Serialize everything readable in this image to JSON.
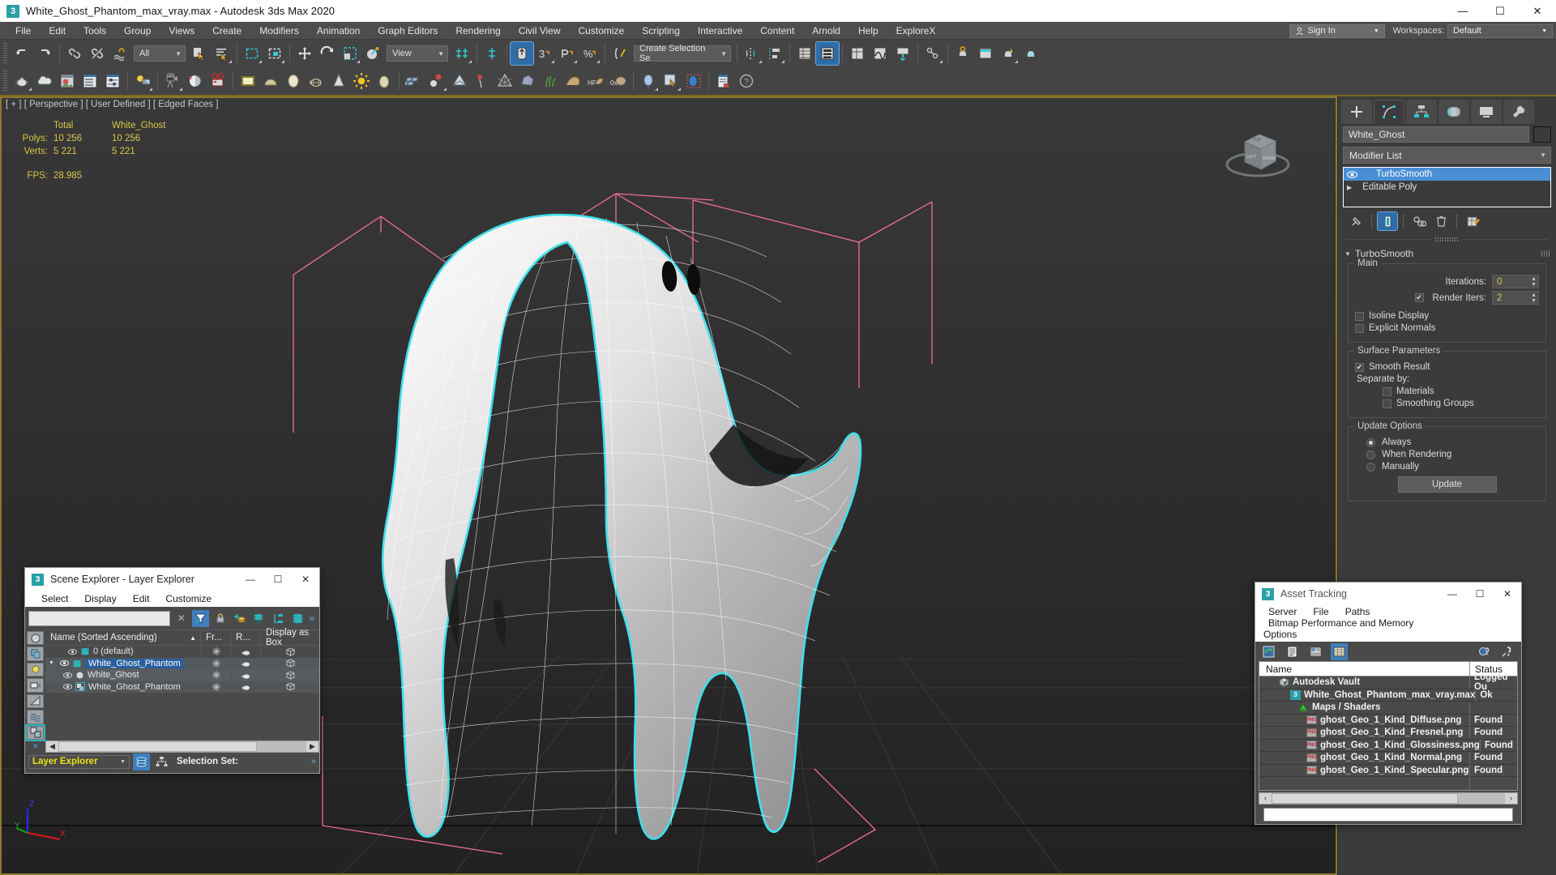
{
  "titlebar": {
    "app_icon": "3",
    "title": "White_Ghost_Phantom_max_vray.max - Autodesk 3ds Max 2020",
    "minimize": "—",
    "maximize": "☐",
    "close": "✕"
  },
  "menubar": {
    "items": [
      "File",
      "Edit",
      "Tools",
      "Group",
      "Views",
      "Create",
      "Modifiers",
      "Animation",
      "Graph Editors",
      "Rendering",
      "Civil View",
      "Customize",
      "Scripting",
      "Interactive",
      "Content",
      "Arnold",
      "Help",
      "ExploreX"
    ],
    "sign_in": "Sign In",
    "workspaces_label": "Workspaces:",
    "workspace_value": "Default"
  },
  "toolbar": {
    "selection_filter": "All",
    "reference_coordinate": "View",
    "named_selection_sets": "Create Selection Se",
    "row1_icons": [
      "undo-icon",
      "redo-icon",
      "select-and-link-icon",
      "unlink-selection-icon",
      "bind-to-space-warp-icon",
      "select-object-icon",
      "select-by-name-icon",
      "rectangular-selection-region-icon",
      "window-crossing-icon",
      "select-and-move-icon",
      "select-and-rotate-icon",
      "select-and-scale-icon",
      "placement-tool-icon",
      "use-center-flyout-icon",
      "select-and-manipulate-icon",
      "snaps-toggle-icon",
      "angle-snap-icon",
      "percent-snap-icon",
      "spinner-snap-icon",
      "edit-named-selection-icon",
      "mirror-icon",
      "align-icon",
      "layer-explorer-icon",
      "scene-explorer-icon",
      "toggle-scene-explorer-icon",
      "curve-editor-icon",
      "schematic-view-icon",
      "material-editor-icon",
      "render-setup-icon",
      "rendered-frame-window-icon",
      "render-production-icon",
      "render-iterative-icon"
    ],
    "row2_icons": [
      "teapot-icon",
      "cloud-icon",
      "bitmap-icon",
      "properties-icon",
      "adjust-icon",
      "light-icon",
      "camera-icon",
      "helper-icon",
      "render-camera-icon",
      "plane-icon",
      "dome-icon",
      "sphere-icon",
      "wireframe-teapot-icon",
      "cone-icon",
      "sun-icon",
      "egg-icon",
      "cloth-icon",
      "particle-icon",
      "envelope-icon",
      "pin-icon",
      "pyramid-icon",
      "rock-icon",
      "grass-icon",
      "fur-icon",
      "hf-icon",
      "ox-icon",
      "balloon-icon",
      "map-pick-icon",
      "selection-balloon-icon",
      "document-icon",
      "help-icon"
    ]
  },
  "viewport": {
    "label": "[ + ] [ Perspective ] [ User Defined ] [ Edged Faces ]",
    "stats": {
      "col_total": "Total",
      "col_object": "White_Ghost",
      "rows": [
        {
          "label": "Polys:",
          "total": "10 256",
          "object": "10 256"
        },
        {
          "label": "Verts:",
          "total": "5 221",
          "object": "5 221"
        }
      ],
      "fps_label": "FPS:",
      "fps_value": "28.985"
    },
    "axis": {
      "x": "X",
      "y": "Y",
      "z": "Z"
    },
    "viewcube": {
      "top": "TOP",
      "left": "LEFT",
      "front": "FRONT"
    },
    "colors": {
      "selection_outline": "#3ee0ec",
      "gizmo_pink": "#f06ba0",
      "axis_x": "#d01818",
      "axis_y": "#11a011",
      "axis_z": "#2a2aee",
      "stats_text": "#d8c84a",
      "viewport_border": "#8a7a2e"
    }
  },
  "command_panel": {
    "tabs": [
      {
        "name": "create-tab",
        "icon": "plus-icon",
        "active": false
      },
      {
        "name": "modify-tab",
        "icon": "modify-icon",
        "active": true
      },
      {
        "name": "hierarchy-tab",
        "icon": "hierarchy-icon",
        "active": false
      },
      {
        "name": "motion-tab",
        "icon": "motion-icon",
        "active": false
      },
      {
        "name": "display-tab",
        "icon": "display-icon",
        "active": false
      },
      {
        "name": "utilities-tab",
        "icon": "wrench-icon",
        "active": false
      }
    ],
    "object_name": "White_Ghost",
    "modifier_list_label": "Modifier List",
    "stack": [
      {
        "label": "TurboSmooth",
        "selected": true
      },
      {
        "label": "Editable Poly",
        "selected": false
      }
    ],
    "stack_tools": [
      "pin-stack-icon",
      "show-end-result-icon",
      "make-unique-icon",
      "remove-modifier-icon",
      "configure-sets-icon"
    ],
    "rollout": {
      "title": "TurboSmooth",
      "main": {
        "group_title": "Main",
        "iterations_label": "Iterations:",
        "iterations_value": "0",
        "render_iters_label": "Render Iters:",
        "render_iters_value": "2",
        "render_iters_checked": true,
        "isoline_display_label": "Isoline Display",
        "isoline_display_checked": false,
        "explicit_normals_label": "Explicit Normals",
        "explicit_normals_checked": false
      },
      "surface": {
        "group_title": "Surface Parameters",
        "smooth_result_label": "Smooth Result",
        "smooth_result_checked": true,
        "separate_by_label": "Separate by:",
        "materials_label": "Materials",
        "materials_checked": false,
        "smoothing_groups_label": "Smoothing Groups",
        "smoothing_groups_checked": false
      },
      "update": {
        "group_title": "Update Options",
        "always_label": "Always",
        "when_rendering_label": "When Rendering",
        "manually_label": "Manually",
        "selected": "Always",
        "button_label": "Update"
      }
    }
  },
  "scene_explorer": {
    "app_icon": "3",
    "title": "Scene Explorer - Layer Explorer",
    "minimize": "—",
    "maximize": "☐",
    "close": "✕",
    "menu": [
      "Select",
      "Display",
      "Edit",
      "Customize"
    ],
    "search_value": "",
    "clear_icon": "✕",
    "toolbar_icons": [
      "filter-icon",
      "lock-icon",
      "add-layer-icon",
      "select-highlighted-icon",
      "layer-hierarchy-icon",
      "layers-icon"
    ],
    "overflow": "»",
    "columns": [
      "Name (Sorted Ascending)",
      "Fr...",
      "R...",
      "Display as Box"
    ],
    "sort_arrow": "▲",
    "rows": [
      {
        "indent": 1,
        "name": "0 (default)",
        "type": "layer",
        "selected": false,
        "expanded": false,
        "arrow": ""
      },
      {
        "indent": 1,
        "name": "White_Ghost_Phantom",
        "type": "layer",
        "selected": true,
        "expanded": true,
        "arrow": "▼"
      },
      {
        "indent": 2,
        "name": "White_Ghost",
        "type": "object",
        "selected": false,
        "expanded": false,
        "arrow": ""
      },
      {
        "indent": 2,
        "name": "White_Ghost_Phantom",
        "type": "group",
        "selected": false,
        "expanded": false,
        "arrow": ""
      }
    ],
    "footer_combo": "Layer Explorer",
    "selection_set_label": "Selection Set:",
    "footer_icons": [
      "layers-view-icon",
      "hierarchy-view-icon"
    ]
  },
  "asset_tracking": {
    "app_icon": "3",
    "title": "Asset Tracking",
    "minimize": "—",
    "maximize": "☐",
    "close": "✕",
    "menu": [
      "Server",
      "File",
      "Paths",
      "Bitmap Performance and Memory",
      "Options"
    ],
    "toolbar_icons": [
      "refresh-icon",
      "list-view-icon",
      "detail-view-icon",
      "grid-view-icon"
    ],
    "right_icons": [
      "add-help-icon",
      "help-icon"
    ],
    "columns": [
      "Name",
      "Status"
    ],
    "rows": [
      {
        "indent": 1,
        "icon": "vault-icon",
        "name": "Autodesk Vault",
        "status": "Logged Ou"
      },
      {
        "indent": 2,
        "icon": "max-icon",
        "name": "White_Ghost_Phantom_max_vray.max",
        "status": "Ok"
      },
      {
        "indent": 2,
        "icon": "maps-icon",
        "name": "Maps / Shaders",
        "status": ""
      },
      {
        "indent": 3,
        "icon": "png-icon",
        "name": "ghost_Geo_1_Kind_Diffuse.png",
        "status": "Found"
      },
      {
        "indent": 3,
        "icon": "png-icon",
        "name": "ghost_Geo_1_Kind_Fresnel.png",
        "status": "Found"
      },
      {
        "indent": 3,
        "icon": "png-icon",
        "name": "ghost_Geo_1_Kind_Glossiness.png",
        "status": "Found"
      },
      {
        "indent": 3,
        "icon": "png-icon",
        "name": "ghost_Geo_1_Kind_Normal.png",
        "status": "Found"
      },
      {
        "indent": 3,
        "icon": "png-icon",
        "name": "ghost_Geo_1_Kind_Specular.png",
        "status": "Found"
      }
    ],
    "scroll_left": "‹",
    "scroll_right": "›",
    "path_field_value": ""
  }
}
